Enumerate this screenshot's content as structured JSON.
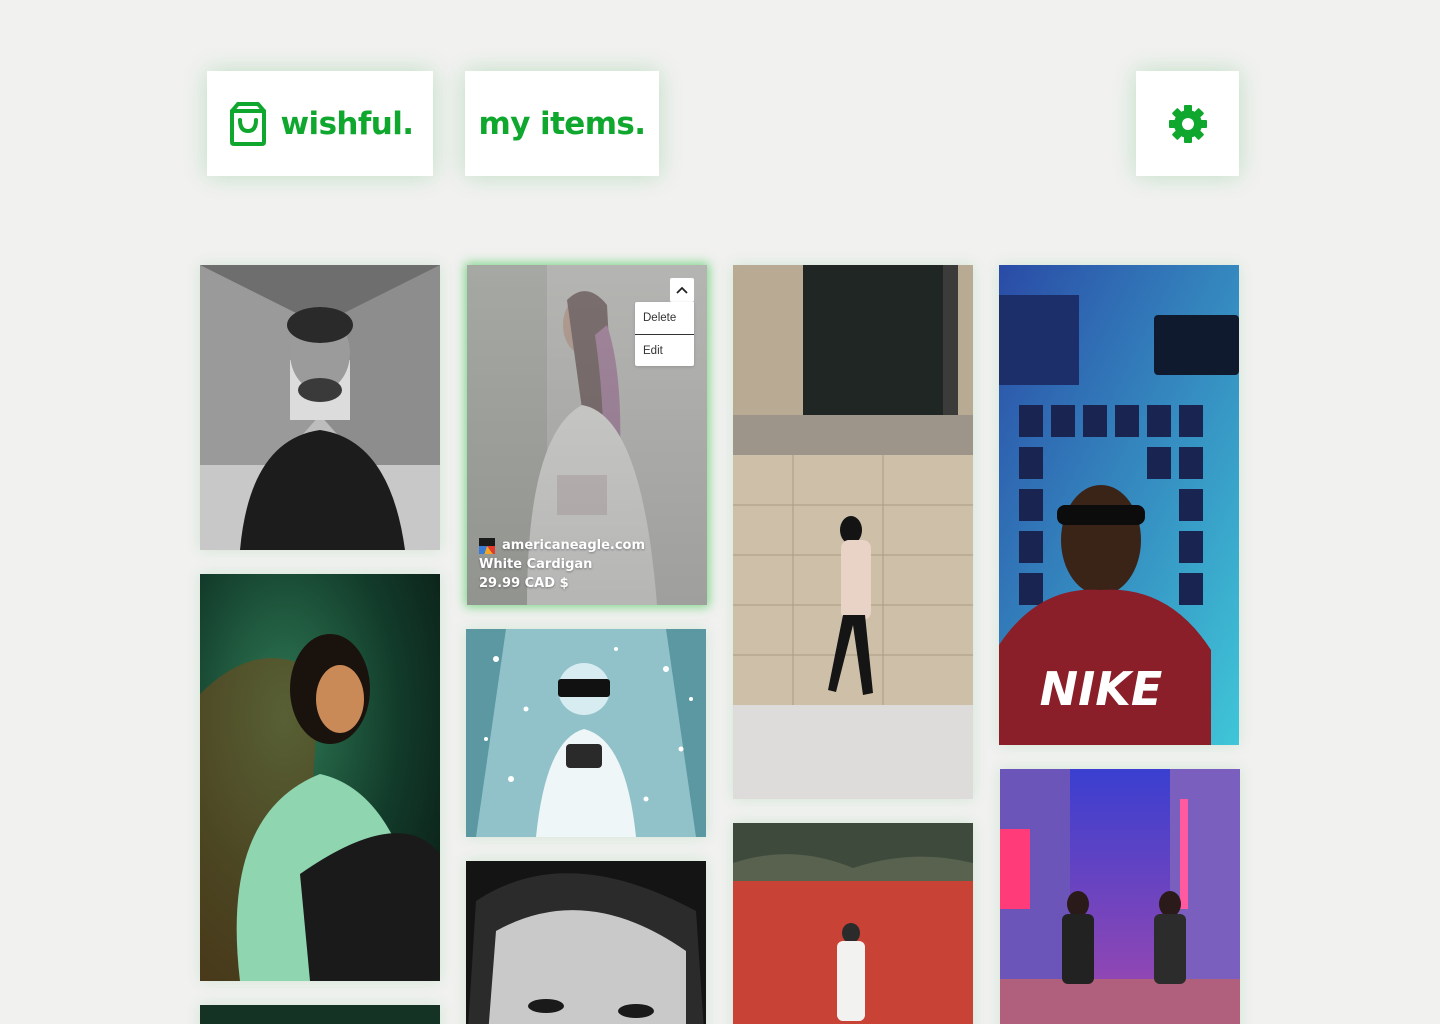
{
  "header": {
    "brand": {
      "icon": "shopping-bag-icon",
      "label": "wishful."
    },
    "nav": {
      "my_items_label": "my items."
    },
    "settings": {
      "icon": "gear-icon"
    }
  },
  "colors": {
    "brand_green": "#0fa72e",
    "background": "#f1f1f0",
    "card": "#ffffff"
  },
  "active_item": {
    "menu_toggle_icon": "chevron-up-icon",
    "menu": {
      "delete_label": "Delete",
      "edit_label": "Edit"
    },
    "store_icon": "store-favicon",
    "store": "americaneagle.com",
    "name": "White Cardigan",
    "price": "29.99 CAD $"
  },
  "gallery": {
    "items": [
      {
        "subject": "man in black t-shirt on bridge"
      },
      {
        "subject": "woman with braided hair in white cardigan"
      },
      {
        "subject": "man walking past stone columns"
      },
      {
        "subject": "man in red nike t-shirt"
      },
      {
        "subject": "woman in sweater under teal light"
      },
      {
        "subject": "person with vr headset and camera"
      },
      {
        "subject": "man in white coat by red wall"
      },
      {
        "subject": "black and white portrait of woman"
      },
      {
        "subject": "two men on neon street"
      },
      {
        "subject": "dark green item"
      }
    ]
  }
}
